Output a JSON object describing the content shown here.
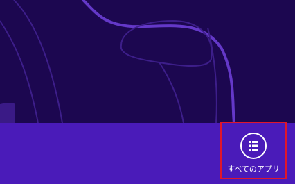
{
  "colors": {
    "background": "#1c0750",
    "app_bar": "#4a1bb9",
    "swirl": "#6a3fd0",
    "highlight_border": "#e0162b",
    "icon": "#ffffff"
  },
  "app_bar": {
    "all_apps": {
      "label": "すべてのアプリ",
      "icon": "list-icon"
    }
  }
}
